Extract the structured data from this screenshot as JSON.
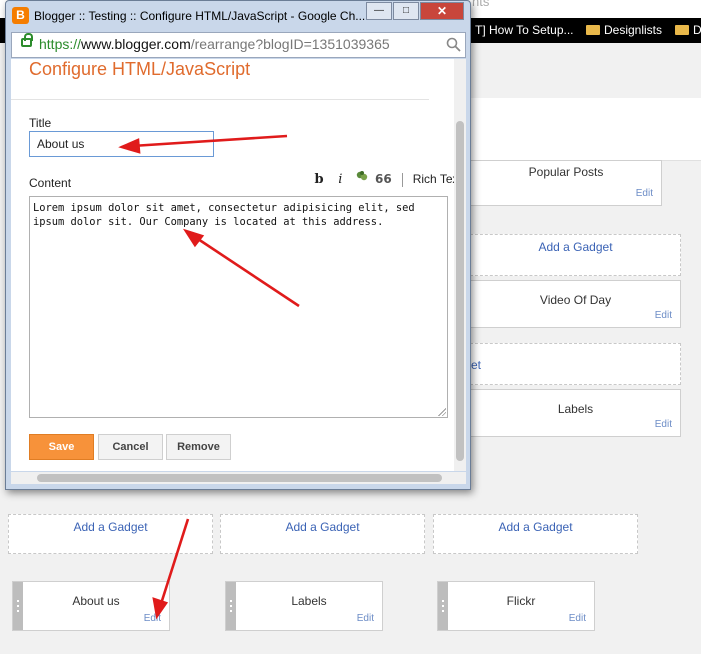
{
  "background": {
    "top_fragment": "nts",
    "bookmarks": [
      {
        "label": "T] How To Setup..."
      },
      {
        "label": "Designlists"
      },
      {
        "label": "D"
      }
    ],
    "gadgets_right": [
      {
        "title": "Popular Posts",
        "edit": "Edit"
      },
      {
        "add": "Add a Gadget"
      },
      {
        "title": "Video Of Day",
        "edit": "Edit"
      },
      {
        "add_fragment": "et"
      },
      {
        "title": "Labels",
        "edit": "Edit"
      }
    ],
    "add_gadget_row": [
      "Add a Gadget",
      "Add a Gadget",
      "Add a Gadget"
    ],
    "gadgets_bottom": [
      {
        "title": "About us",
        "edit": "Edit"
      },
      {
        "title": "Labels",
        "edit": "Edit"
      },
      {
        "title": "Flickr",
        "edit": "Edit"
      }
    ]
  },
  "window": {
    "title": "Blogger :: Testing :: Configure HTML/JavaScript - Google Ch...",
    "buttons": {
      "minimize": "—",
      "maximize": "□",
      "close": "✕"
    },
    "url": {
      "scheme": "https://",
      "host": "www.blogger.com",
      "path": "/rearrange?blogID=1351039365"
    }
  },
  "dialog": {
    "heading": "Configure HTML/JavaScript",
    "title_label": "Title",
    "title_value": "About us",
    "content_label": "Content",
    "toolbar": {
      "bold": "b",
      "italic": "i",
      "quote": "66",
      "rich_text": "Rich Text"
    },
    "content_value": "Lorem ipsum dolor sit amet, consectetur adipisicing elit, sed ipsum dolor sit. Our Company is located at this address.",
    "buttons": {
      "save": "Save",
      "cancel": "Cancel",
      "remove": "Remove"
    }
  },
  "colors": {
    "accent_orange": "#f7923a",
    "heading_orange": "#e06b2d",
    "link_blue": "#3b63b5",
    "annotation_red": "#e01b1b"
  },
  "icons": [
    "blogger-logo-icon",
    "lock-icon",
    "zoom-icon",
    "folder-icon",
    "link-icon",
    "drag-handle-icon",
    "annotation-arrow-icon"
  ]
}
